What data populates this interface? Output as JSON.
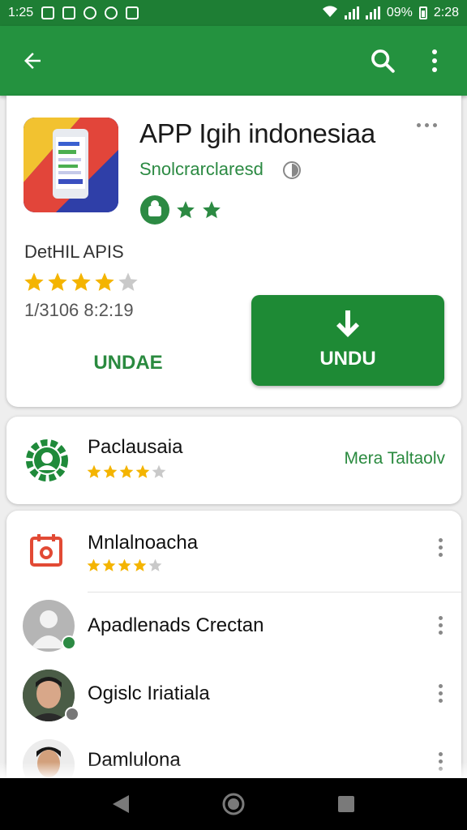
{
  "status_bar": {
    "time_left": "1:25",
    "battery_pct": "09%",
    "time_right": "2:28"
  },
  "app_bar": {
    "back_icon": "arrow-left-icon",
    "search_icon": "search-icon",
    "menu_icon": "more-vert-icon"
  },
  "app": {
    "title": "APP Igih indonesiaa",
    "developer": "Snolcrarclaresd",
    "detail_title": "DetHIL APIS",
    "rating_stars": 4,
    "date": "1/3106 8:2:19",
    "secondary_button": "UNDAE",
    "primary_button": "UNDU"
  },
  "featured": {
    "title": "Paclausaia",
    "rating_stars": 4,
    "link": "Mera Taltaolv"
  },
  "list": [
    {
      "title": "Mnlalnoacha",
      "rating_stars": 4,
      "icon": "calendar-icon"
    },
    {
      "title": "Apadlenads Crectan",
      "icon": "avatar-placeholder-icon"
    },
    {
      "title": "Ogislc Iriatiala",
      "icon": "avatar-photo"
    },
    {
      "title": "Damlulona",
      "icon": "avatar-photo"
    }
  ],
  "colors": {
    "primary": "#24923f",
    "status_bar": "#1e7e34",
    "accent_text": "#2a8a3f",
    "star": "#f4b400"
  }
}
